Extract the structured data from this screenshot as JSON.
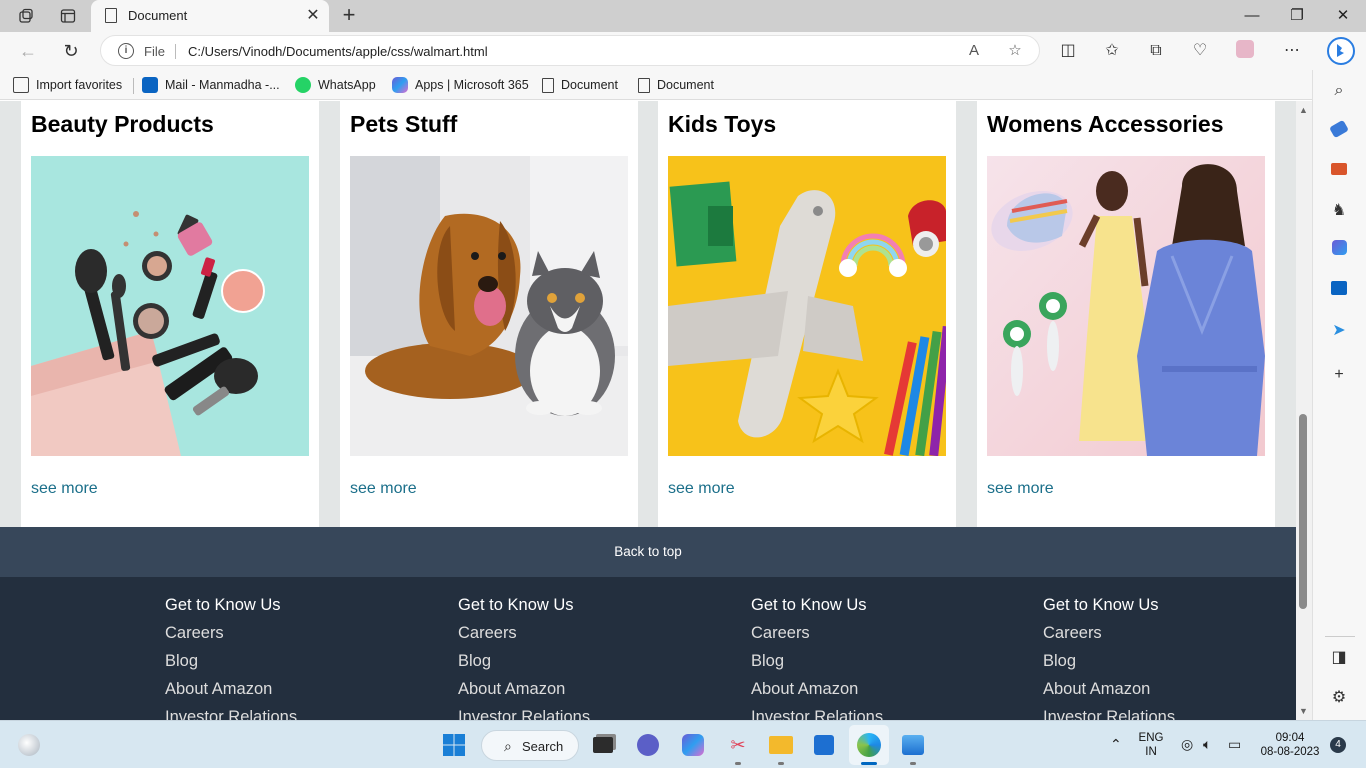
{
  "browser": {
    "tab_title": "Document",
    "address": {
      "scheme_label": "File",
      "url": "C:/Users/Vinodh/Documents/apple/css/walmart.html"
    },
    "favorites": [
      {
        "label": "Import favorites",
        "icon": "import-icon"
      },
      {
        "label": "Mail - Manmadha -...",
        "icon": "outlook-icon"
      },
      {
        "label": "WhatsApp",
        "icon": "whatsapp-icon"
      },
      {
        "label": "Apps | Microsoft 365",
        "icon": "m365-icon"
      },
      {
        "label": "Document",
        "icon": "document-icon"
      },
      {
        "label": "Document",
        "icon": "document-icon"
      }
    ]
  },
  "page": {
    "cards": [
      {
        "title": "Beauty Products",
        "link": "see more"
      },
      {
        "title": "Pets Stuff",
        "link": "see more"
      },
      {
        "title": "Kids Toys",
        "link": "see more"
      },
      {
        "title": "Womens Accessories",
        "link": "see more"
      }
    ],
    "back_to_top": "Back to top",
    "footer_columns": [
      {
        "heading": "Get to Know Us",
        "links": [
          "Careers",
          "Blog",
          "About Amazon",
          "Investor Relations"
        ]
      },
      {
        "heading": "Get to Know Us",
        "links": [
          "Careers",
          "Blog",
          "About Amazon",
          "Investor Relations"
        ]
      },
      {
        "heading": "Get to Know Us",
        "links": [
          "Careers",
          "Blog",
          "About Amazon",
          "Investor Relations"
        ]
      },
      {
        "heading": "Get to Know Us",
        "links": [
          "Careers",
          "Blog",
          "About Amazon",
          "Investor Relations"
        ]
      }
    ]
  },
  "taskbar": {
    "search_label": "Search",
    "language": "ENG",
    "region": "IN",
    "time": "09:04",
    "date": "08-08-2023",
    "notification_count": "4"
  },
  "colors": {
    "link": "#1b6f8a",
    "back_to_top_bg": "#37475a",
    "footer_bg": "#232f3e",
    "page_bg": "#e3e6e6"
  }
}
